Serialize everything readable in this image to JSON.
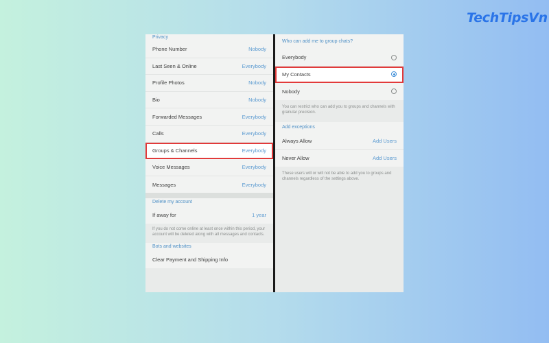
{
  "brand": {
    "logo_text": "TechTipsVn"
  },
  "left": {
    "privacy_header": "Privacy",
    "privacy_items": [
      {
        "label": "Phone Number",
        "value": "Nobody"
      },
      {
        "label": "Last Seen & Online",
        "value": "Everybody"
      },
      {
        "label": "Profile Photos",
        "value": "Nobody"
      },
      {
        "label": "Bio",
        "value": "Nobody"
      },
      {
        "label": "Forwarded Messages",
        "value": "Everybody"
      },
      {
        "label": "Calls",
        "value": "Everybody"
      },
      {
        "label": "Groups & Channels",
        "value": "Everybody"
      },
      {
        "label": "Voice Messages",
        "value": "Everybody"
      },
      {
        "label": "Messages",
        "value": "Everybody"
      }
    ],
    "delete_header": "Delete my account",
    "delete_item": {
      "label": "If away for",
      "value": "1 year"
    },
    "delete_note": "If you do not come online at least once within this period, your account will be deleted along with all messages and contacts.",
    "bots_header": "Bots and websites",
    "bots_item": "Clear Payment and Shipping Info"
  },
  "right": {
    "question_header": "Who can add me to group chats?",
    "options": [
      {
        "label": "Everybody",
        "selected": false
      },
      {
        "label": "My Contacts",
        "selected": true
      },
      {
        "label": "Nobody",
        "selected": false
      }
    ],
    "options_note": "You can restrict who can add you to groups and channels with granular precision.",
    "exceptions_header": "Add exceptions",
    "exceptions": [
      {
        "label": "Always Allow",
        "action": "Add Users"
      },
      {
        "label": "Never Allow",
        "action": "Add Users"
      }
    ],
    "exceptions_note": "These users will or will not be able to add you to groups and channels regardless of the settings above."
  },
  "colors": {
    "accent": "#5c9bd1",
    "highlight": "#e23a3a"
  }
}
